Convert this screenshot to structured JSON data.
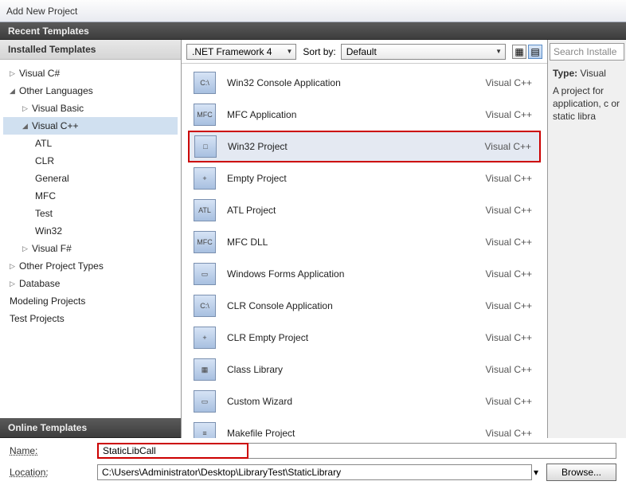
{
  "window": {
    "title": "Add New Project"
  },
  "recent_header": "Recent Templates",
  "installed_header": "Installed Templates",
  "online_header": "Online Templates",
  "tree": {
    "visual_csharp": "Visual C#",
    "other_languages": "Other Languages",
    "visual_basic": "Visual Basic",
    "visual_cpp": "Visual C++",
    "atl": "ATL",
    "clr": "CLR",
    "general": "General",
    "mfc": "MFC",
    "test": "Test",
    "win32": "Win32",
    "visual_fsharp": "Visual F#",
    "other_project_types": "Other Project Types",
    "database": "Database",
    "modeling": "Modeling Projects",
    "test_projects": "Test Projects"
  },
  "filters": {
    "framework": ".NET Framework 4",
    "sort_label": "Sort by:",
    "sort_value": "Default"
  },
  "search_placeholder": "Search Installe",
  "templates": [
    {
      "name": "Win32 Console Application",
      "lang": "Visual C++",
      "icon": "C:\\"
    },
    {
      "name": "MFC Application",
      "lang": "Visual C++",
      "icon": "MFC"
    },
    {
      "name": "Win32 Project",
      "lang": "Visual C++",
      "icon": "□",
      "highlighted": true
    },
    {
      "name": "Empty Project",
      "lang": "Visual C++",
      "icon": "+"
    },
    {
      "name": "ATL Project",
      "lang": "Visual C++",
      "icon": "ATL"
    },
    {
      "name": "MFC DLL",
      "lang": "Visual C++",
      "icon": "MFC"
    },
    {
      "name": "Windows Forms Application",
      "lang": "Visual C++",
      "icon": "▭"
    },
    {
      "name": "CLR Console Application",
      "lang": "Visual C++",
      "icon": "C:\\"
    },
    {
      "name": "CLR Empty Project",
      "lang": "Visual C++",
      "icon": "+"
    },
    {
      "name": "Class Library",
      "lang": "Visual C++",
      "icon": "▦"
    },
    {
      "name": "Custom Wizard",
      "lang": "Visual C++",
      "icon": "▭"
    },
    {
      "name": "Makefile Project",
      "lang": "Visual C++",
      "icon": "≡"
    }
  ],
  "description": {
    "type_label": "Type:",
    "type_value": "Visual",
    "text": "A project for application, c or static libra"
  },
  "form": {
    "name_label": "Name:",
    "name_value": "StaticLibCall",
    "location_label": "Location:",
    "location_value": "C:\\Users\\Administrator\\Desktop\\LibraryTest\\StaticLibrary",
    "browse": "Browse..."
  }
}
